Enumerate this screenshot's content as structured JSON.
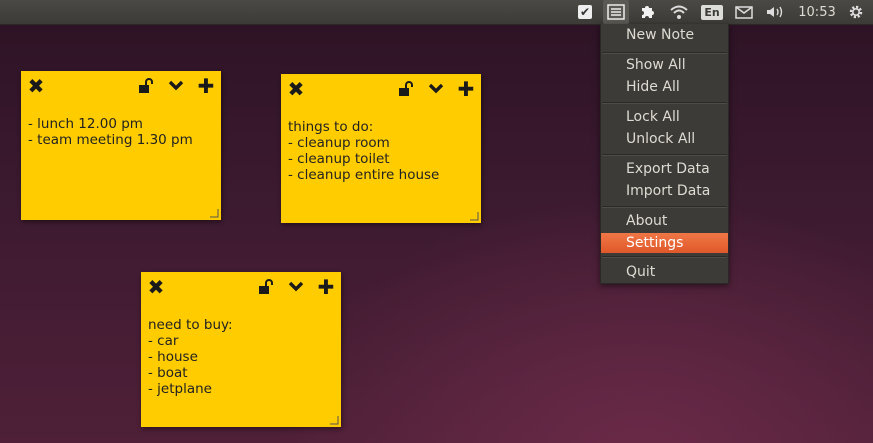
{
  "panel": {
    "indicators": [
      "check-icon",
      "notes-indicator-icon",
      "puzzle-icon",
      "wifi-icon"
    ],
    "keyboard_layout": "En",
    "mail": "mail-icon",
    "volume": "volume-icon",
    "clock": "10:53",
    "session": "gear-icon"
  },
  "menu": {
    "items": [
      {
        "label": "New Note"
      },
      {
        "label": "Show All"
      },
      {
        "label": "Hide All"
      },
      {
        "label": "Lock All"
      },
      {
        "label": "Unlock All"
      },
      {
        "label": "Export Data"
      },
      {
        "label": "Import Data"
      },
      {
        "label": "About"
      },
      {
        "label": "Settings"
      },
      {
        "label": "Quit"
      }
    ],
    "selected": "Settings"
  },
  "notes": [
    {
      "text": "- lunch 12.00 pm\n- team meeting 1.30 pm"
    },
    {
      "text": "things to do:\n- cleanup room\n- cleanup toilet\n- cleanup entire house"
    },
    {
      "text": "need to buy:\n- car\n- house\n- boat\n- jetplane"
    }
  ],
  "note_color": "#ffcc00",
  "accent": "#e95420"
}
